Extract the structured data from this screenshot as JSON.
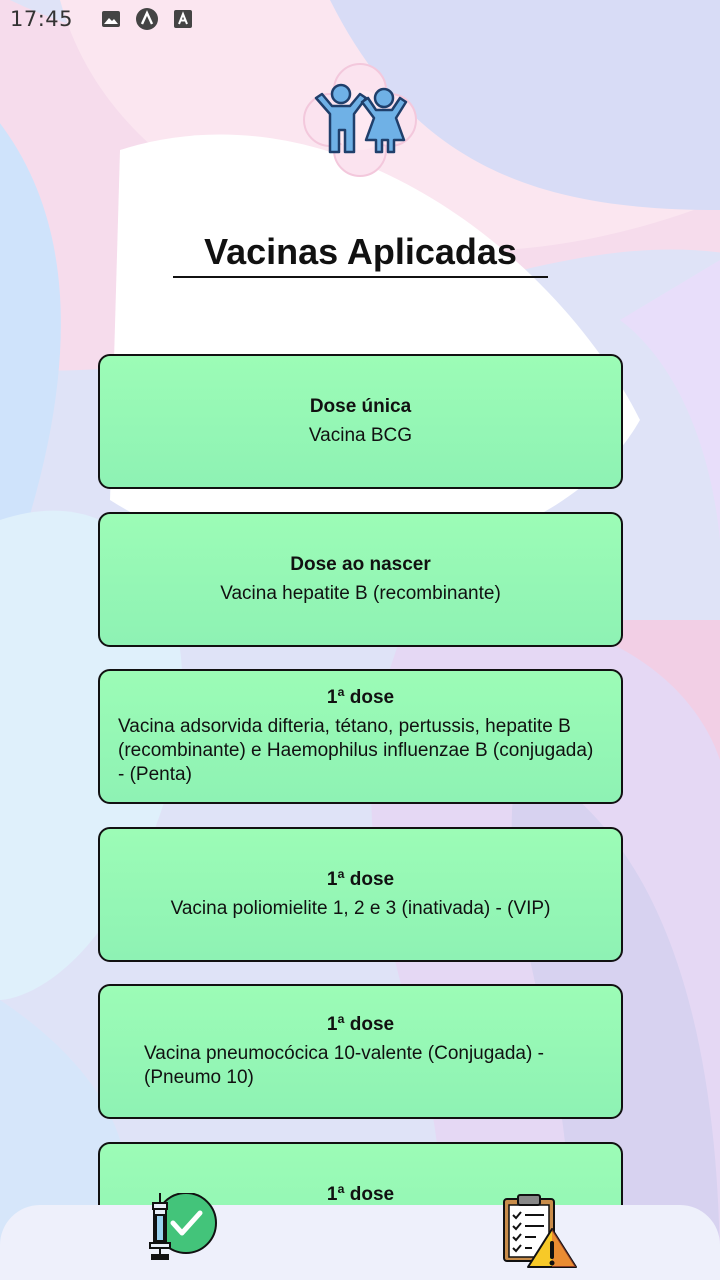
{
  "status_bar": {
    "time": "17:45",
    "icons": [
      "gallery-icon",
      "app-a-icon",
      "font-a-icon"
    ]
  },
  "header": {
    "title": "Vacinas Aplicadas"
  },
  "cards": [
    {
      "dose": "Dose única",
      "vaccine": "Vacina BCG"
    },
    {
      "dose": "Dose ao nascer",
      "vaccine": "Vacina hepatite B (recombinante)"
    },
    {
      "dose": "1ª dose",
      "vaccine": "Vacina adsorvida difteria, tétano, pertussis, hepatite B (recombinante) e Haemophilus influenzae B (conjugada) - (Penta)"
    },
    {
      "dose": "1ª dose",
      "vaccine": "Vacina poliomielite 1, 2 e 3 (inativada) - (VIP)"
    },
    {
      "dose": "1ª dose",
      "vaccine": "Vacina pneumocócica 10-valente (Conjugada) -(Pneumo 10)"
    },
    {
      "dose": "1ª dose",
      "vaccine": ""
    }
  ],
  "bottom_nav": {
    "items": [
      "syringe-check-icon",
      "clipboard-warning-icon"
    ]
  },
  "colors": {
    "card_bg": "#9cfcb6",
    "nav_bg": "#eef0fb"
  }
}
